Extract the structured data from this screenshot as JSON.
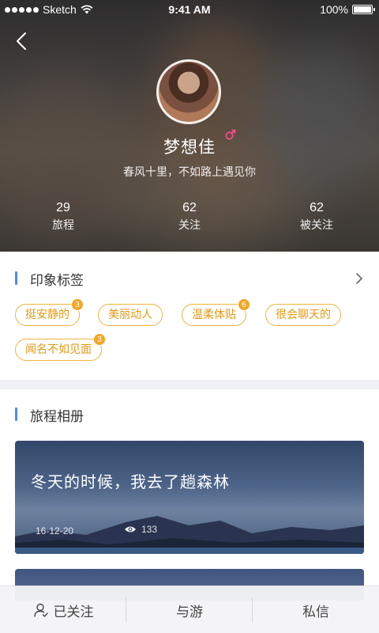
{
  "status_bar": {
    "carrier": "Sketch",
    "time": "9:41 AM",
    "battery": "100%"
  },
  "profile": {
    "name": "梦想佳",
    "gender_icon": "male-symbol-icon",
    "signature": "春风十里，不如路上遇见你",
    "stats": [
      {
        "value": "29",
        "label": "旅程"
      },
      {
        "value": "62",
        "label": "关注"
      },
      {
        "value": "62",
        "label": "被关注"
      }
    ]
  },
  "tags_section": {
    "title": "印象标签",
    "tags": [
      {
        "label": "挺安静的",
        "count": "3"
      },
      {
        "label": "美丽动人",
        "count": ""
      },
      {
        "label": "温柔体贴",
        "count": "6"
      },
      {
        "label": "很会聊天的",
        "count": ""
      },
      {
        "label": "闻名不如见面",
        "count": "3"
      }
    ]
  },
  "album_section": {
    "title": "旅程相册",
    "albums": [
      {
        "title": "冬天的时候，我去了趟森林",
        "date": "16-12-20",
        "views": "133"
      }
    ]
  },
  "bottom_bar": {
    "follow": "已关注",
    "travel": "与游",
    "message": "私信"
  },
  "colors": {
    "accent_blue": "#4a8cf0",
    "tag_orange": "#f2b43c",
    "badge_orange": "#f5a623",
    "gender_pink": "#ff4f8b"
  }
}
